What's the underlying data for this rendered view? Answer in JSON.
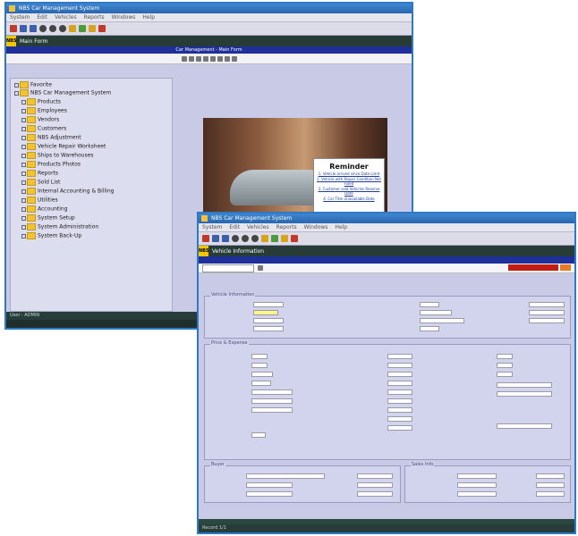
{
  "window1": {
    "title": "NBS Car Management System",
    "tab": "Main Form",
    "banner": "Car Management - Main Form",
    "tree": {
      "root": "Favorite",
      "system": "NBS Car Management System",
      "items": [
        "Products",
        "Employees",
        "Vendors",
        "Customers",
        "NBS Adjustment",
        "Vehicle Repair Worksheet",
        "Ships to Warehouses",
        "Products Photos",
        "Reports",
        "Sold List",
        "Internal Accounting & Billing",
        "Utilities",
        "Accounting",
        "System Setup",
        "System Administration",
        "System Back-Up"
      ]
    },
    "reminder": {
      "title": "Reminder",
      "lines": [
        "1. Vehicle arrived since Date Limit",
        "2. Vehicle with Repair Condition Not Fixed",
        "3. Customer sold Vehicles Reserve Date",
        "4. Car Title Unavailable Date"
      ]
    },
    "status": "User : ADMIN"
  },
  "window2": {
    "title": "NBS Car Management System",
    "tab": "Vehicle Information",
    "status": "Record 1/1",
    "sections": [
      "Vehicle Information",
      "Price & Expense",
      "Sales Info",
      "Buyer"
    ]
  }
}
